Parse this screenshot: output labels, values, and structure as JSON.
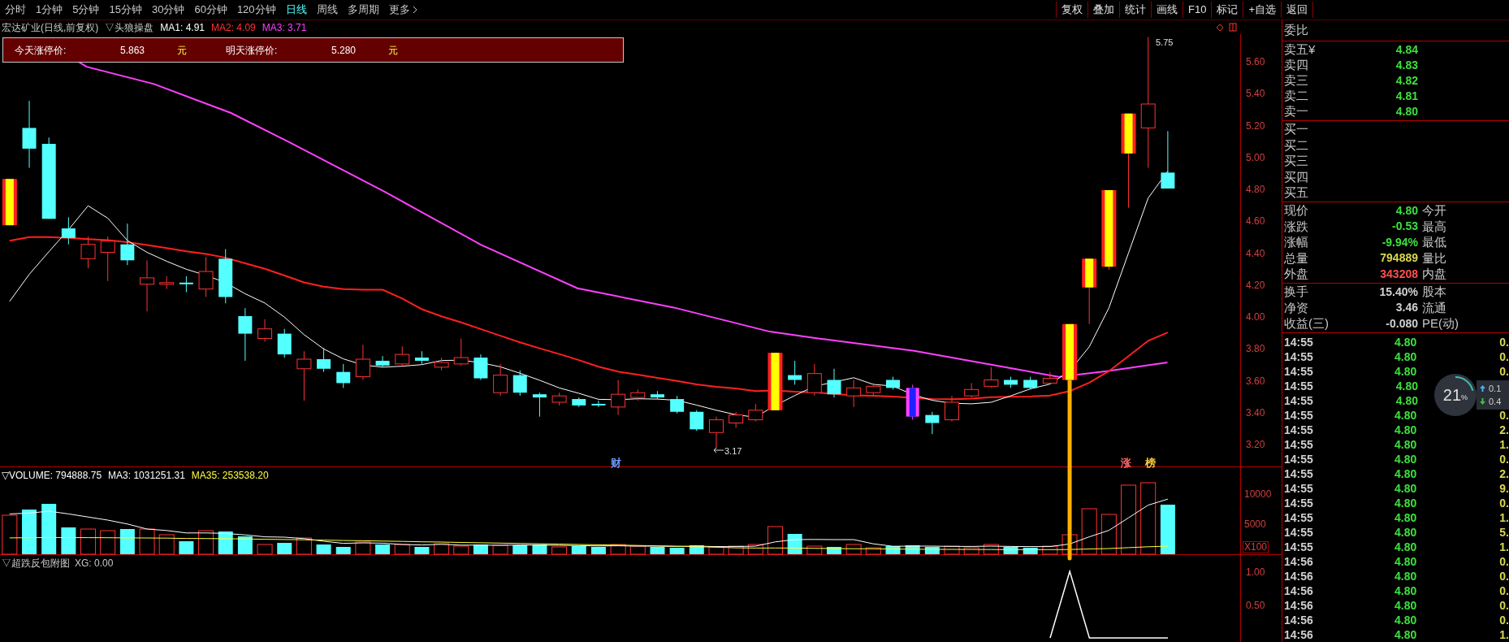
{
  "toolbar": {
    "periods": [
      {
        "label": "分时",
        "selected": false
      },
      {
        "label": "1分钟",
        "selected": false
      },
      {
        "label": "5分钟",
        "selected": false
      },
      {
        "label": "15分钟",
        "selected": false
      },
      {
        "label": "30分钟",
        "selected": false
      },
      {
        "label": "60分钟",
        "selected": false
      },
      {
        "label": "120分钟",
        "selected": false
      },
      {
        "label": "日线",
        "selected": true
      },
      {
        "label": "周线",
        "selected": false
      },
      {
        "label": "多周期",
        "selected": false
      }
    ],
    "more": "更多",
    "actions": [
      "复权",
      "叠加",
      "统计",
      "画线",
      "F10",
      "标记",
      "+自选",
      "返回"
    ]
  },
  "chart": {
    "title": "宏达矿业(日线,前复权)",
    "indicator": "▽头狼操盘",
    "ma": [
      {
        "label": "MA1: 4.91",
        "color": "#ffffff"
      },
      {
        "label": "MA2: 4.09",
        "color": "#ff3030"
      },
      {
        "label": "MA3: 3.71",
        "color": "#ff40ff"
      }
    ],
    "limit_box": [
      {
        "label": "今天涨停价:",
        "value": "5.863",
        "unit": "元"
      },
      {
        "label": "明天涨停价:",
        "value": "5.280",
        "unit": "元"
      }
    ],
    "price_axis": [
      "5.60",
      "5.40",
      "5.20",
      "5.00",
      "4.80",
      "4.60",
      "4.40",
      "4.20",
      "4.00",
      "3.80",
      "3.60",
      "3.40",
      "3.20"
    ],
    "high_label": "5.75",
    "low_label": "3.17",
    "markers": [
      {
        "text": "财",
        "color": "#6a9cff"
      },
      {
        "text": "涨",
        "color": "#ff6a6a"
      },
      {
        "text": "榜",
        "color": "#ffd040"
      }
    ]
  },
  "volume": {
    "legend": [
      {
        "text": "▽VOLUME: 794888.75",
        "color": "#ffffff"
      },
      {
        "text": "MA3: 1031251.31",
        "color": "#ffffff"
      },
      {
        "text": "MA35: 253538.20",
        "color": "#ffff40"
      }
    ],
    "axis": [
      "10000",
      "5000"
    ],
    "unit": "X100"
  },
  "sub_chart": {
    "legend": "▽超跌反包附图",
    "value": "XG: 0.00",
    "axis": [
      "1.00",
      "0.50"
    ]
  },
  "quote": {
    "ratio_label": "委比",
    "asks": [
      {
        "label": "卖五¥",
        "value": "4.84"
      },
      {
        "label": "卖四",
        "value": "4.83"
      },
      {
        "label": "卖三",
        "value": "4.82"
      },
      {
        "label": "卖二",
        "value": "4.81"
      },
      {
        "label": "卖一",
        "value": "4.80"
      }
    ],
    "bids": [
      "买一",
      "买二",
      "买三",
      "买四",
      "买五"
    ],
    "stats": [
      {
        "label": "现价",
        "value": "4.80",
        "label2": "今开",
        "color": "#3ee03e"
      },
      {
        "label": "涨跌",
        "value": "-0.53",
        "label2": "最高",
        "color": "#3ee03e"
      },
      {
        "label": "涨幅",
        "value": "-9.94%",
        "label2": "最低",
        "color": "#3ee03e"
      },
      {
        "label": "总量",
        "value": "794889",
        "label2": "量比",
        "color": "#d8d850"
      },
      {
        "label": "外盘",
        "value": "343208",
        "label2": "内盘",
        "color": "#ff5050"
      }
    ],
    "stats2": [
      {
        "label": "换手",
        "value": "15.40%",
        "label2": "股本"
      },
      {
        "label": "净资",
        "value": "3.46",
        "label2": "流通"
      },
      {
        "label": "收益(三)",
        "value": "-0.080",
        "label2": "PE(动)"
      }
    ],
    "ticks": [
      {
        "time": "14:55",
        "price": "4.80",
        "volume": "0."
      },
      {
        "time": "14:55",
        "price": "4.80",
        "volume": "0."
      },
      {
        "time": "14:55",
        "price": "4.80",
        "volume": "0."
      },
      {
        "time": "14:55",
        "price": "4.80"
      },
      {
        "time": "14:55",
        "price": "4.80"
      },
      {
        "time": "14:55",
        "price": "4.80",
        "volume": "0."
      },
      {
        "time": "14:55",
        "price": "4.80",
        "volume": "2."
      },
      {
        "time": "14:55",
        "price": "4.80",
        "volume": "1."
      },
      {
        "time": "14:55",
        "price": "4.80",
        "volume": "0."
      },
      {
        "time": "14:55",
        "price": "4.80",
        "volume": "2."
      },
      {
        "time": "14:55",
        "price": "4.80",
        "volume": "9."
      },
      {
        "time": "14:55",
        "price": "4.80",
        "volume": "0."
      },
      {
        "time": "14:55",
        "price": "4.80",
        "volume": "1."
      },
      {
        "time": "14:55",
        "price": "4.80",
        "volume": "5."
      },
      {
        "time": "14:55",
        "price": "4.80",
        "volume": "1."
      },
      {
        "time": "14:56",
        "price": "4.80",
        "volume": "0."
      },
      {
        "time": "14:56",
        "price": "4.80",
        "volume": "0."
      },
      {
        "time": "14:56",
        "price": "4.80",
        "volume": "0."
      },
      {
        "time": "14:56",
        "price": "4.80",
        "volume": "0."
      },
      {
        "time": "14:56",
        "price": "4.80",
        "volume": "0."
      },
      {
        "time": "14:56",
        "price": "4.80",
        "volume": "1."
      }
    ]
  },
  "speed_widget": {
    "percent": "21",
    "unit": "%",
    "level": 0.21,
    "up": "0.1",
    "down": "0.4"
  }
}
